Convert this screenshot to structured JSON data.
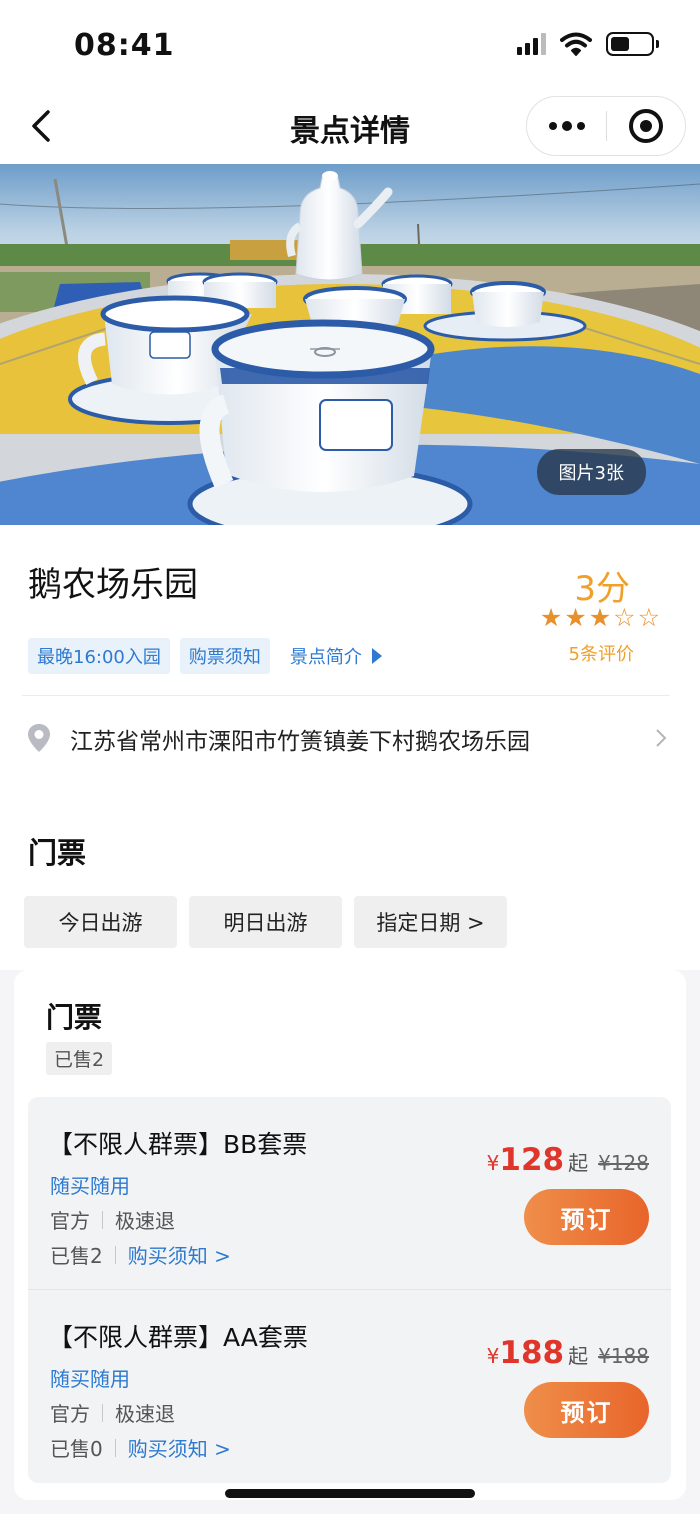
{
  "status_bar": {
    "time": "08:41"
  },
  "nav": {
    "title": "景点详情"
  },
  "hero": {
    "photo_count": "图片3张"
  },
  "spot": {
    "name": "鹅农场乐园",
    "score": "3分",
    "rating_stars": 3,
    "rating_max": 5,
    "review_count": "5条评价",
    "tags": [
      "最晚16:00入园",
      "购票须知"
    ],
    "intro_link": "景点简介",
    "address": "江苏省常州市溧阳市竹箦镇姜下村鹅农场乐园"
  },
  "tickets_section": {
    "title": "门票",
    "date_tabs": [
      "今日出游",
      "明日出游",
      "指定日期 >"
    ]
  },
  "ticket_card": {
    "title": "门票",
    "sold": "已售2",
    "products": [
      {
        "name": "【不限人群票】BB套票",
        "use": "随买随用",
        "source": "官方",
        "refund": "极速退",
        "sold": "已售2",
        "notice": "购买须知 >",
        "currency": "¥",
        "price": "128",
        "from": "起",
        "original_price": "¥128",
        "book_label": "预订"
      },
      {
        "name": "【不限人群票】AA套票",
        "use": "随买随用",
        "source": "官方",
        "refund": "极速退",
        "sold": "已售0",
        "notice": "购买须知 >",
        "currency": "¥",
        "price": "188",
        "from": "起",
        "original_price": "¥188",
        "book_label": "预订"
      }
    ]
  },
  "colors": {
    "accent_blue": "#2e7ad0",
    "price_red": "#e0352b",
    "score_orange": "#f0a029",
    "button_orange": "#e8652a"
  }
}
